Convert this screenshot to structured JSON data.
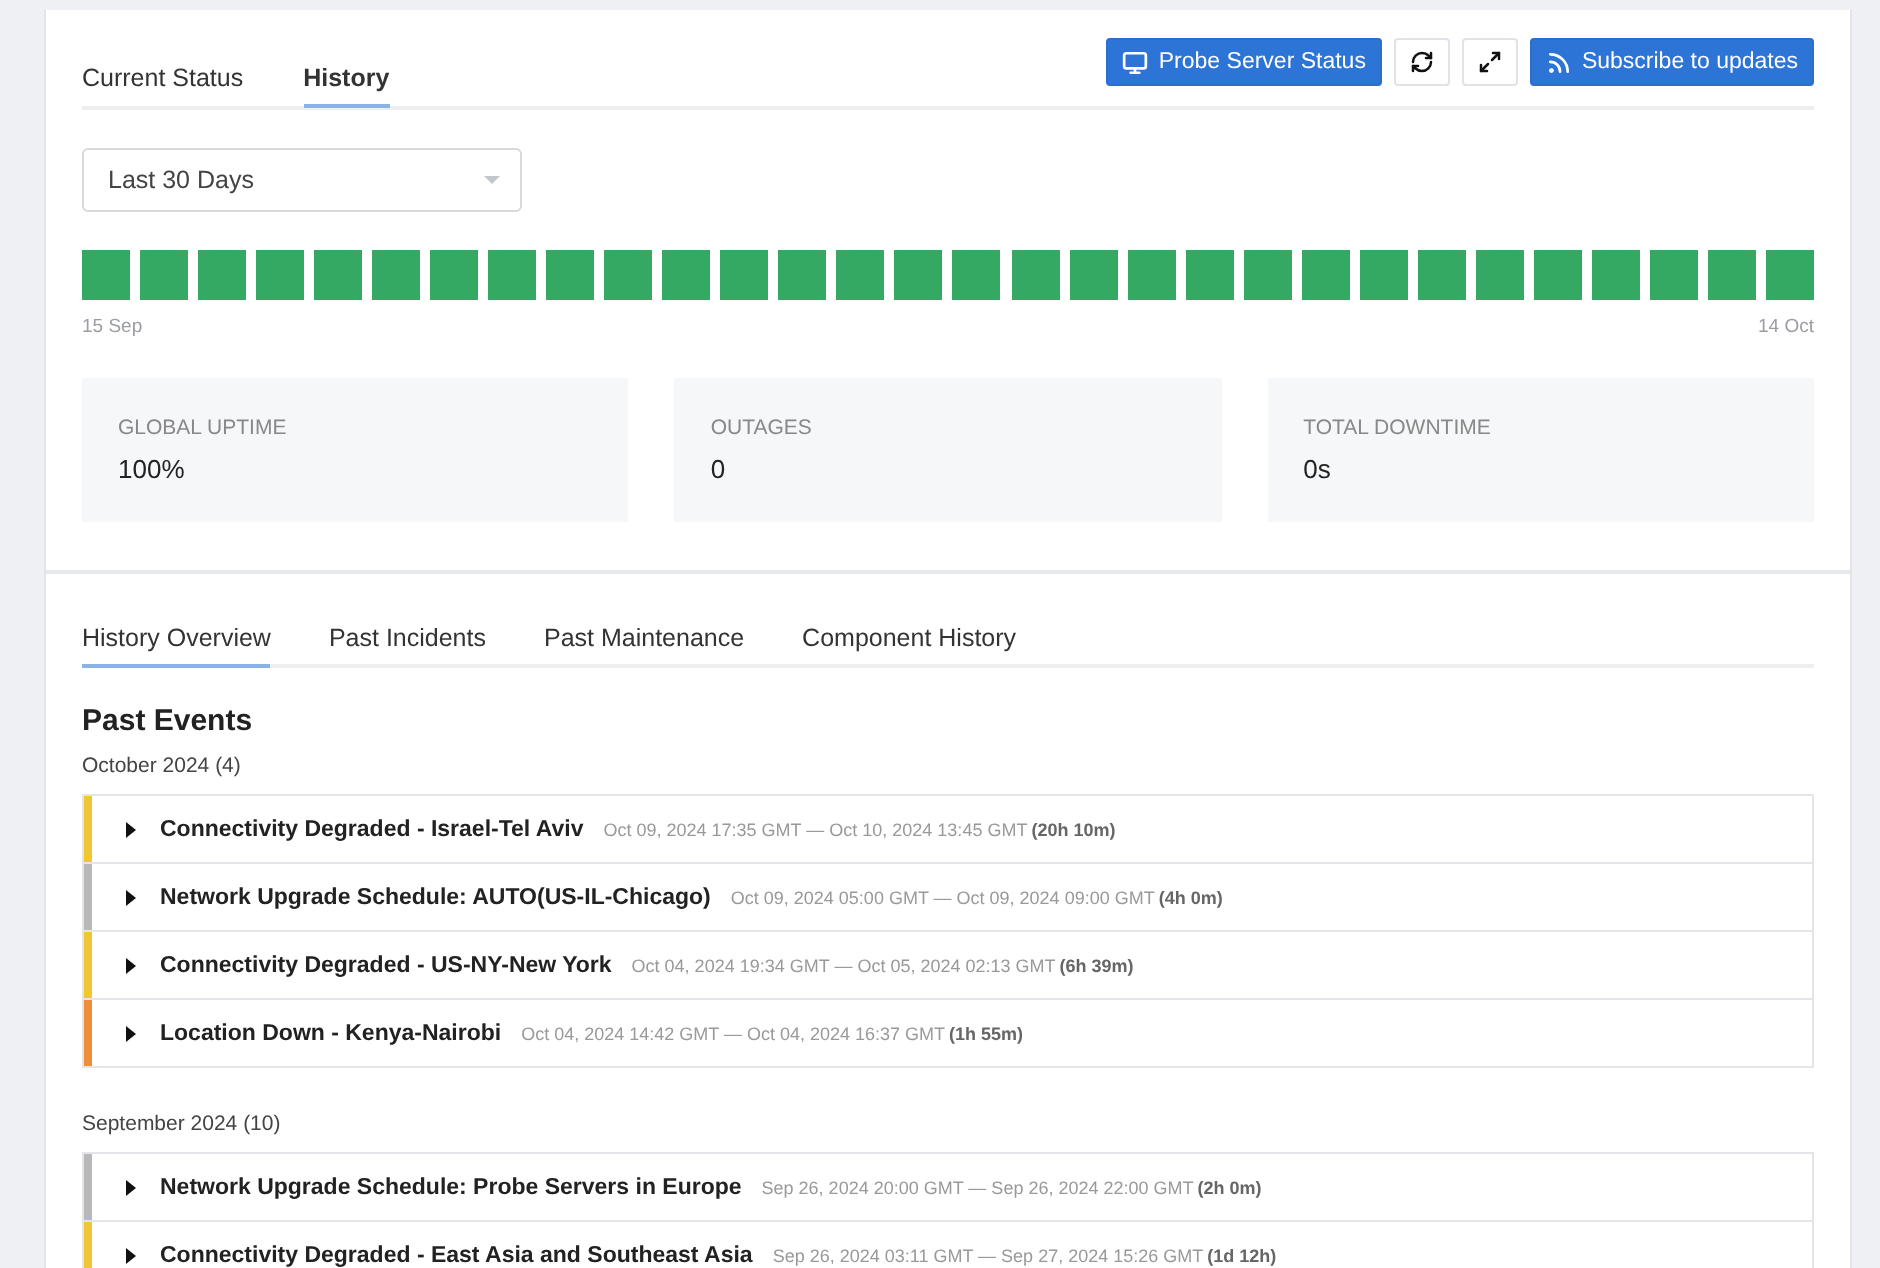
{
  "top_tabs": [
    {
      "label": "Current Status",
      "selected": false
    },
    {
      "label": "History",
      "selected": true
    }
  ],
  "actions": [
    {
      "kind": "primary",
      "label": "Probe Server Status"
    },
    {
      "kind": "icon"
    },
    {
      "kind": "icon"
    },
    {
      "kind": "primary",
      "label": "Subscribe to updates"
    }
  ],
  "range_select": {
    "value": "Last 30 Days"
  },
  "days": [
    {
      "color": "#34a963"
    },
    {
      "color": "#34a963"
    },
    {
      "color": "#34a963"
    },
    {
      "color": "#34a963"
    },
    {
      "color": "#34a963"
    },
    {
      "color": "#34a963"
    },
    {
      "color": "#34a963"
    },
    {
      "color": "#34a963"
    },
    {
      "color": "#34a963"
    },
    {
      "color": "#34a963"
    },
    {
      "color": "#34a963"
    },
    {
      "color": "#34a963"
    },
    {
      "color": "#34a963"
    },
    {
      "color": "#34a963"
    },
    {
      "color": "#34a963"
    },
    {
      "color": "#34a963"
    },
    {
      "color": "#34a963"
    },
    {
      "color": "#34a963"
    },
    {
      "color": "#34a963"
    },
    {
      "color": "#34a963"
    },
    {
      "color": "#34a963"
    },
    {
      "color": "#34a963"
    },
    {
      "color": "#34a963"
    },
    {
      "color": "#34a963"
    },
    {
      "color": "#34a963"
    },
    {
      "color": "#34a963"
    },
    {
      "color": "#34a963"
    },
    {
      "color": "#34a963"
    },
    {
      "color": "#34a963"
    },
    {
      "color": "#34a963"
    }
  ],
  "range_start": "15 Sep",
  "range_end": "14 Oct",
  "stats": [
    {
      "label": "GLOBAL UPTIME",
      "value": "100%"
    },
    {
      "label": "OUTAGES",
      "value": "0"
    },
    {
      "label": "TOTAL DOWNTIME",
      "value": "0s"
    }
  ],
  "history_tabs": [
    {
      "label": "History Overview",
      "selected": true
    },
    {
      "label": "Past Incidents",
      "selected": false
    },
    {
      "label": "Past Maintenance",
      "selected": false
    },
    {
      "label": "Component History",
      "selected": false
    }
  ],
  "section_title": "Past Events",
  "months": [
    {
      "title": "October 2024",
      "count": "(4)",
      "events": [
        {
          "title": "Connectivity Degraded - Israel-Tel Aviv",
          "range": "Oct 09, 2024 17:35 GMT — Oct 10, 2024 13:45 GMT",
          "duration": "(20h 10m)",
          "color": "#f0c536",
          "expanded": false
        },
        {
          "title": "Network Upgrade Schedule: AUTO(US-IL-Chicago)",
          "range": "Oct 09, 2024 05:00 GMT — Oct 09, 2024 09:00 GMT",
          "duration": "(4h 0m)",
          "color": "#b8b8b8",
          "expanded": false
        },
        {
          "title": "Connectivity Degraded - US-NY-New York",
          "range": "Oct 04, 2024 19:34 GMT — Oct 05, 2024 02:13 GMT",
          "duration": "(6h 39m)",
          "color": "#f0c536",
          "expanded": false
        },
        {
          "title": "Location Down - Kenya-Nairobi",
          "range": "Oct 04, 2024 14:42 GMT — Oct 04, 2024 16:37 GMT",
          "duration": "(1h 55m)",
          "color": "#ef8e38",
          "expanded": false
        }
      ]
    },
    {
      "title": "September 2024",
      "count": "(10)",
      "events": [
        {
          "title": "Network Upgrade Schedule: Probe Servers in Europe",
          "range": "Sep 26, 2024 20:00 GMT — Sep 26, 2024 22:00 GMT",
          "duration": "(2h 0m)",
          "color": "#b8b8b8",
          "expanded": false
        },
        {
          "title": "Connectivity Degraded - East Asia and Southeast Asia",
          "range": "Sep 26, 2024 03:11 GMT — Sep 27, 2024 15:26 GMT",
          "duration": "(1d 12h)",
          "color": "#f0c536",
          "expanded": false
        }
      ]
    }
  ]
}
